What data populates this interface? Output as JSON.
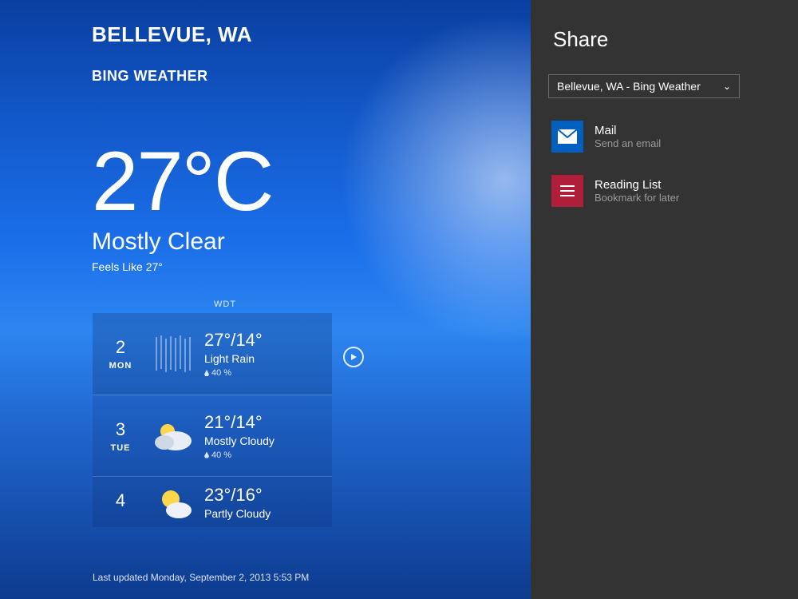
{
  "weather": {
    "location": "BELLEVUE, WA",
    "app_name": "BING WEATHER",
    "temp": "27°C",
    "condition": "Mostly Clear",
    "feels_like": "Feels Like 27°",
    "provider_label": "WDT",
    "last_updated": "Last updated Monday, September 2, 2013 5:53 PM",
    "forecast": [
      {
        "daynum": "2",
        "dayname": "MON",
        "hilo": "27°/14°",
        "cond": "Light Rain",
        "pop": "40 %",
        "icon": "rain"
      },
      {
        "daynum": "3",
        "dayname": "TUE",
        "hilo": "21°/14°",
        "cond": "Mostly Cloudy",
        "pop": "40 %",
        "icon": "mostly-cloudy"
      },
      {
        "daynum": "4",
        "dayname": "",
        "hilo": "23°/16°",
        "cond": "Partly Cloudy",
        "pop": "",
        "icon": "partly-cloudy"
      }
    ]
  },
  "share": {
    "title": "Share",
    "context_selected": "Bellevue, WA - Bing Weather",
    "targets": [
      {
        "title": "Mail",
        "subtitle": "Send an email",
        "icon": "mail"
      },
      {
        "title": "Reading List",
        "subtitle": "Bookmark for later",
        "icon": "reading-list"
      }
    ]
  }
}
